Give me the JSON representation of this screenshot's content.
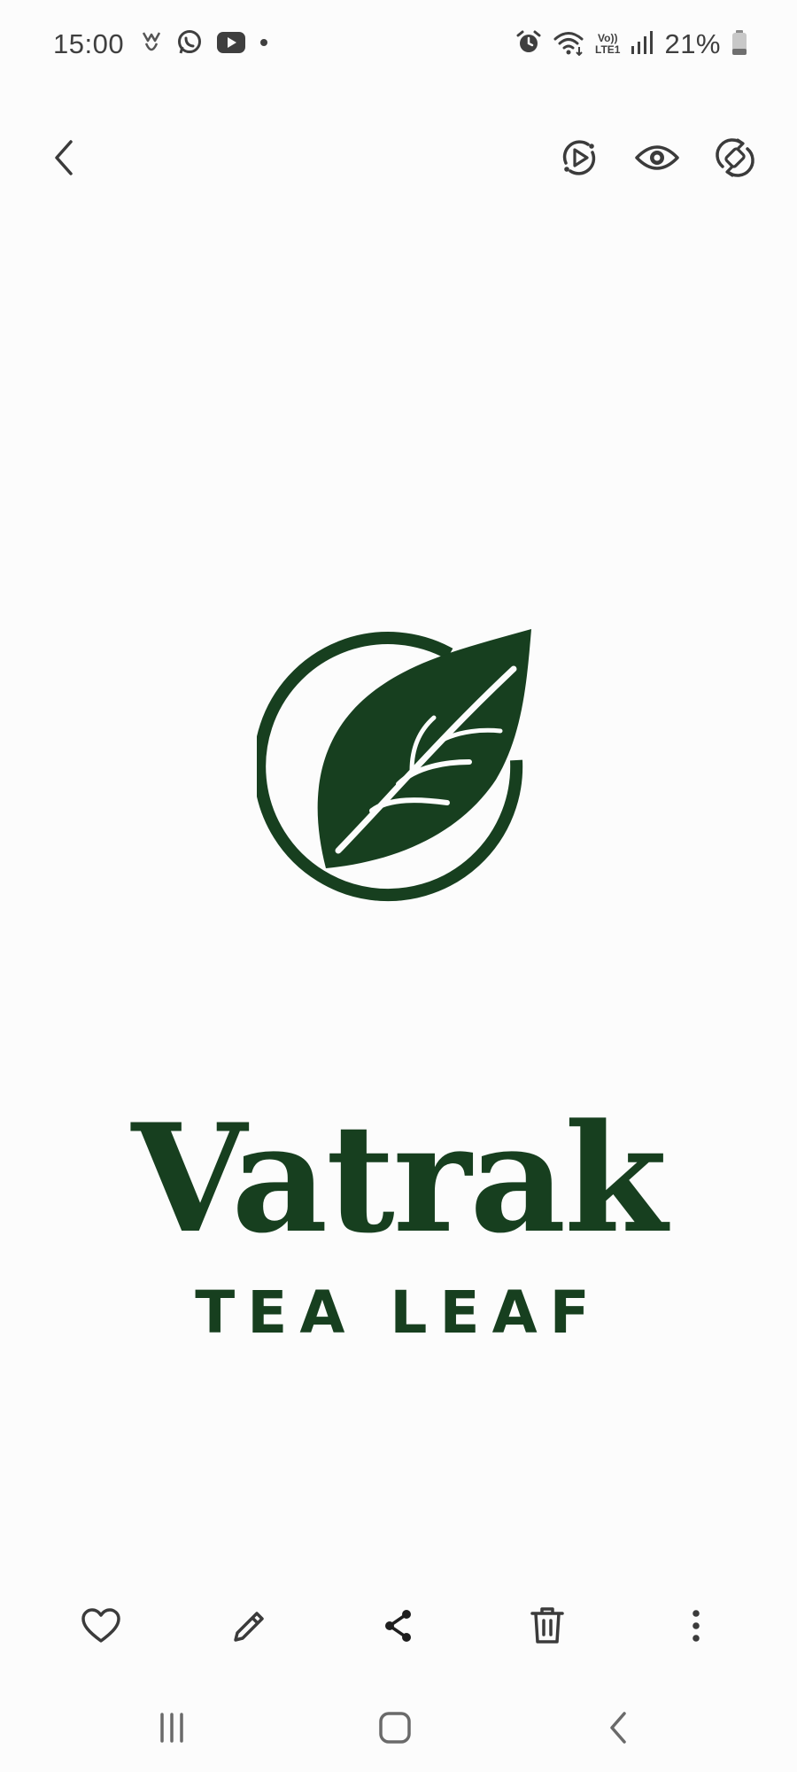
{
  "status_bar": {
    "time": "15:00",
    "battery": "21%",
    "volte_top": "Vo))",
    "volte_bottom": "LTE1",
    "left_icons": [
      "notification-app-icon",
      "whatsapp-icon",
      "youtube-icon",
      "dot-icon"
    ],
    "right_icons": [
      "alarm-icon",
      "wifi-icon",
      "volte-icon",
      "signal-icon",
      "battery-icon"
    ]
  },
  "top_bar": {
    "icons": [
      "back-icon",
      "motion-photo-icon",
      "eye-icon",
      "rotate-icon"
    ]
  },
  "image": {
    "brand_name": "Vatrak",
    "tagline": "TEA LEAF",
    "logo_icon": "tea-leaf-logo-icon",
    "brand_color": "#173f1f"
  },
  "action_bar": {
    "icons": [
      "heart-icon",
      "pencil-icon",
      "share-icon",
      "trash-icon",
      "more-vertical-icon"
    ]
  },
  "nav_bar": {
    "icons": [
      "recents-icon",
      "home-icon",
      "back-chevron-icon"
    ]
  },
  "colors": {
    "background": "#fcfcfc",
    "icon": "#3b3b3b",
    "brand_green": "#173f1f"
  }
}
